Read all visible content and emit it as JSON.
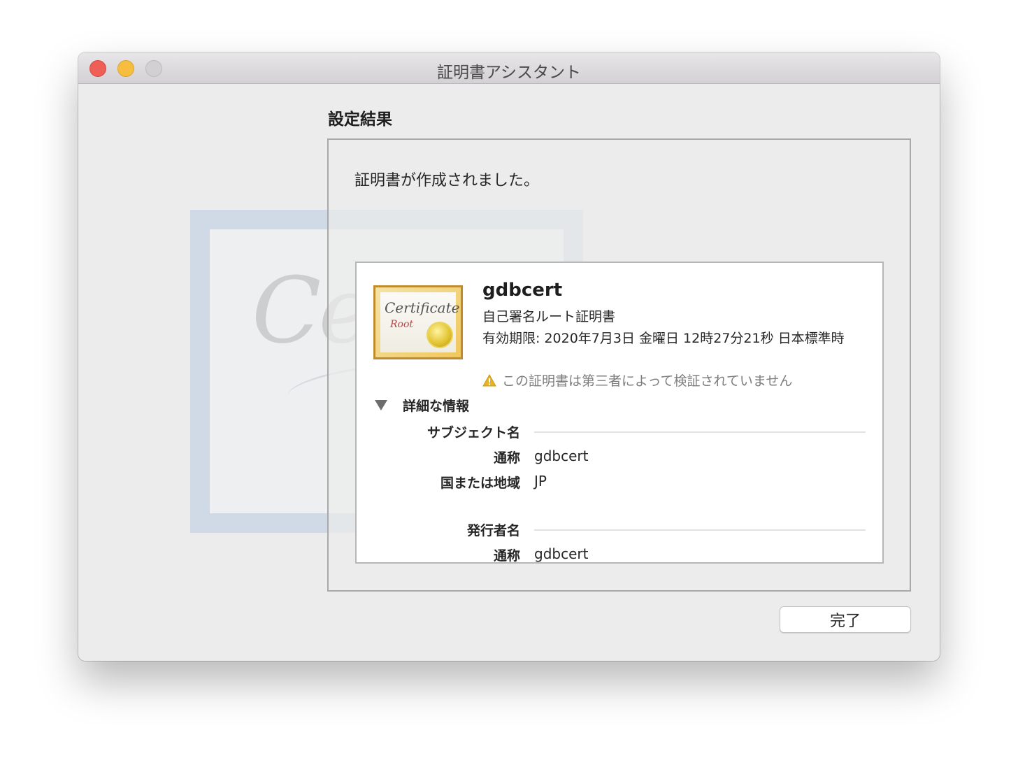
{
  "window": {
    "title": "証明書アシスタント"
  },
  "background_art": {
    "script_text": "Cer"
  },
  "section": {
    "title": "設定結果",
    "message": "証明書が作成されました。"
  },
  "certificate": {
    "icon_script": "Certificate",
    "icon_sub": "Root",
    "name": "gdbcert",
    "type": "自己署名ルート証明書",
    "expiry": "有効期限: 2020年7月3日 金曜日 12時27分21秒 日本標準時",
    "warning": "この証明書は第三者によって検証されていません"
  },
  "details": {
    "label": "詳細な情報",
    "subject_header": "サブジェクト名",
    "subject_common_name_key": "通称",
    "subject_common_name_value": "gdbcert",
    "subject_country_key": "国または地域",
    "subject_country_value": "JP",
    "issuer_header": "発行者名",
    "issuer_common_name_key": "通称",
    "issuer_common_name_value": "gdbcert"
  },
  "buttons": {
    "done_label": "完了"
  },
  "colors": {
    "close": "#ee5f57",
    "minimize": "#f7bd3e",
    "zoom_inactive": "#d2d0d2",
    "warning": "#e6b325"
  }
}
